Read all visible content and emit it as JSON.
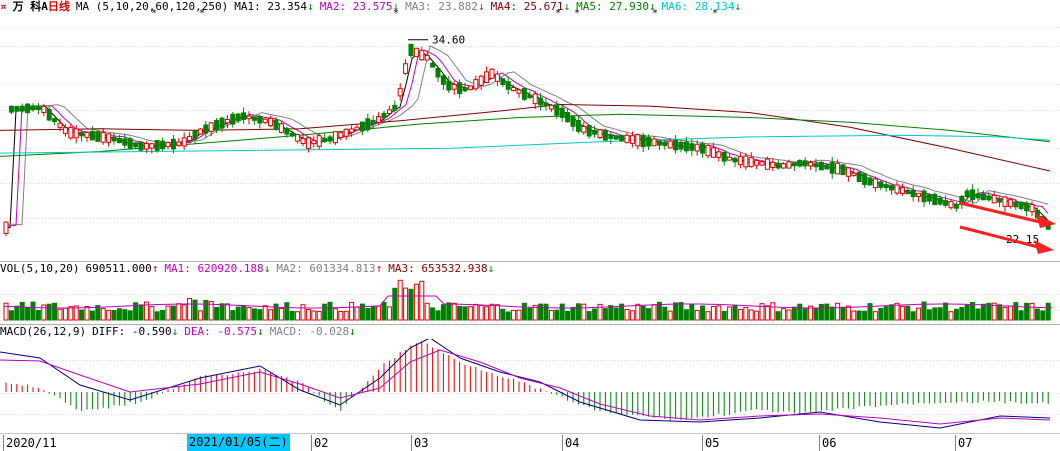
{
  "title": {
    "icon": "stock-logo-icon",
    "name": "万 科A",
    "period": "日线"
  },
  "ma_header": {
    "label": "MA (5,10,20,60,120,250)",
    "items": [
      {
        "text": "MA1: 23.354",
        "arrow": "↓",
        "color": "#000000"
      },
      {
        "text": "MA2: 23.575",
        "arrow": "↓",
        "color": "#c000c0"
      },
      {
        "text": "MA3: 23.882",
        "arrow": "↓",
        "color": "#808080"
      },
      {
        "text": "MA4: 25.671",
        "arrow": "↓",
        "color": "#800000"
      },
      {
        "text": "MA5: 27.930",
        "arrow": "↓",
        "color": "#008000"
      },
      {
        "text": "MA6: 28.134",
        "arrow": "↓",
        "color": "#00c8c8"
      }
    ],
    "star_marker": "*"
  },
  "vol_header": {
    "label": "VOL(5,10,20)",
    "items": [
      {
        "text": "690511.000",
        "arrow": "↑",
        "color": "#000000"
      },
      {
        "text": "MA1: 620920.188",
        "arrow": "↓",
        "color": "#c000c0"
      },
      {
        "text": "MA2: 601334.813",
        "arrow": "↑",
        "color": "#808080"
      },
      {
        "text": "MA3: 653532.938",
        "arrow": "↓",
        "color": "#800000"
      }
    ]
  },
  "macd_header": {
    "label": "MACD(26,12,9)",
    "items": [
      {
        "text": "DIFF: -0.590",
        "arrow": "↓",
        "color": "#000000"
      },
      {
        "text": "DEA: -0.575",
        "arrow": "↓",
        "color": "#c000c0"
      },
      {
        "text": "MACD: -0.028",
        "arrow": "↓",
        "color": "#808080"
      }
    ]
  },
  "chart_data": [
    {
      "type": "candlestick",
      "title": "万 科A 日线",
      "series": [
        {
          "name": "MA1",
          "values": [
            23.354
          ]
        },
        {
          "name": "MA2",
          "values": [
            23.575
          ]
        },
        {
          "name": "MA3",
          "values": [
            23.882
          ]
        },
        {
          "name": "MA4",
          "values": [
            25.671
          ]
        },
        {
          "name": "MA5",
          "values": [
            27.93
          ]
        },
        {
          "name": "MA6",
          "values": [
            28.134
          ]
        }
      ],
      "annotations": [
        {
          "label": "34.60",
          "kind": "high"
        },
        {
          "label": "22.15",
          "kind": "low"
        }
      ],
      "x_ticks": [
        "2020/11",
        "2021/01/05(二)",
        "02",
        "03",
        "04",
        "05",
        "06",
        "07"
      ],
      "ylim": [
        21.5,
        36
      ],
      "colors": {
        "up": "#e00000",
        "down": "#008000",
        "arrow": "#ff2020"
      }
    },
    {
      "type": "bar",
      "title": "VOL(5,10,20)",
      "series": [
        {
          "name": "VOL",
          "values": [
            690511.0
          ]
        },
        {
          "name": "MA1",
          "values": [
            620920.188
          ]
        },
        {
          "name": "MA2",
          "values": [
            601334.813
          ]
        },
        {
          "name": "MA3",
          "values": [
            653532.938
          ]
        }
      ]
    },
    {
      "type": "line",
      "title": "MACD(26,12,9)",
      "series": [
        {
          "name": "DIFF",
          "values": [
            -0.59
          ]
        },
        {
          "name": "DEA",
          "values": [
            -0.575
          ]
        },
        {
          "name": "MACD",
          "values": [
            -0.028
          ]
        }
      ]
    }
  ],
  "axis": {
    "ticks": [
      "2020/11",
      "02",
      "03",
      "04",
      "05",
      "06",
      "07"
    ],
    "cursor_date": "2021/01/05(二)"
  }
}
